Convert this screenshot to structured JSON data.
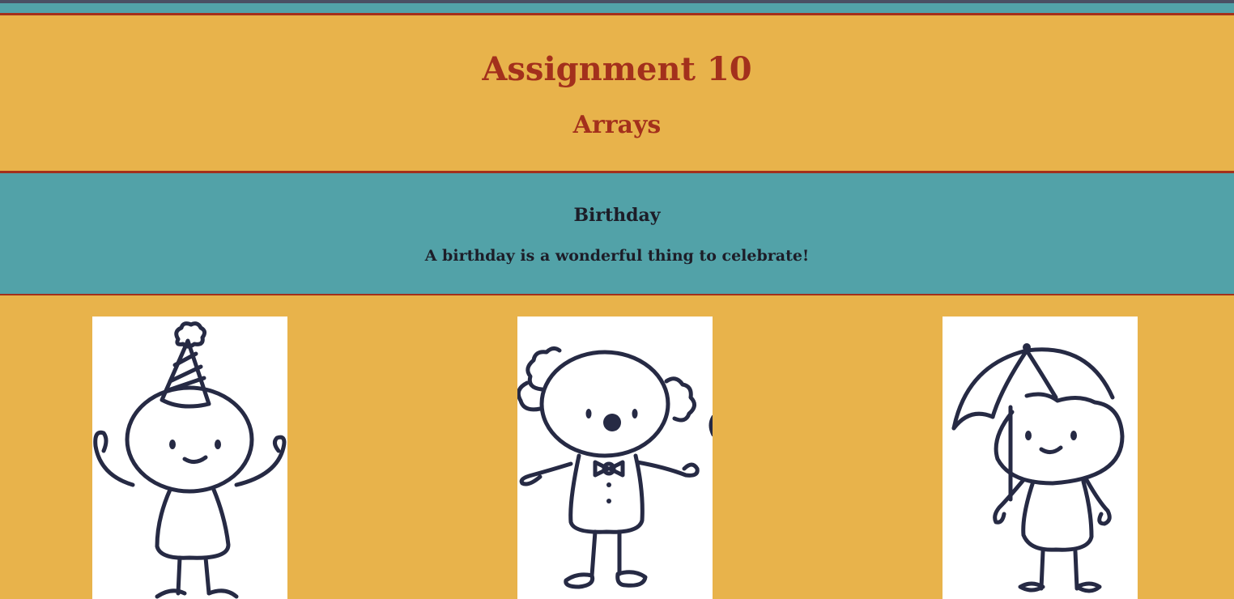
{
  "header": {
    "title": "Assignment 10",
    "subtitle": "Arrays"
  },
  "banner": {
    "heading": "Birthday",
    "text": "A birthday is a wonderful thing to celebrate!"
  },
  "gallery": {
    "images": [
      {
        "name": "party-hat-figure"
      },
      {
        "name": "clown-figure"
      },
      {
        "name": "umbrella-figure"
      }
    ]
  },
  "colors": {
    "accent": "#a3301c",
    "mustard": "#e8b34b",
    "teal": "#52a2a8",
    "ink": "#262a44"
  }
}
